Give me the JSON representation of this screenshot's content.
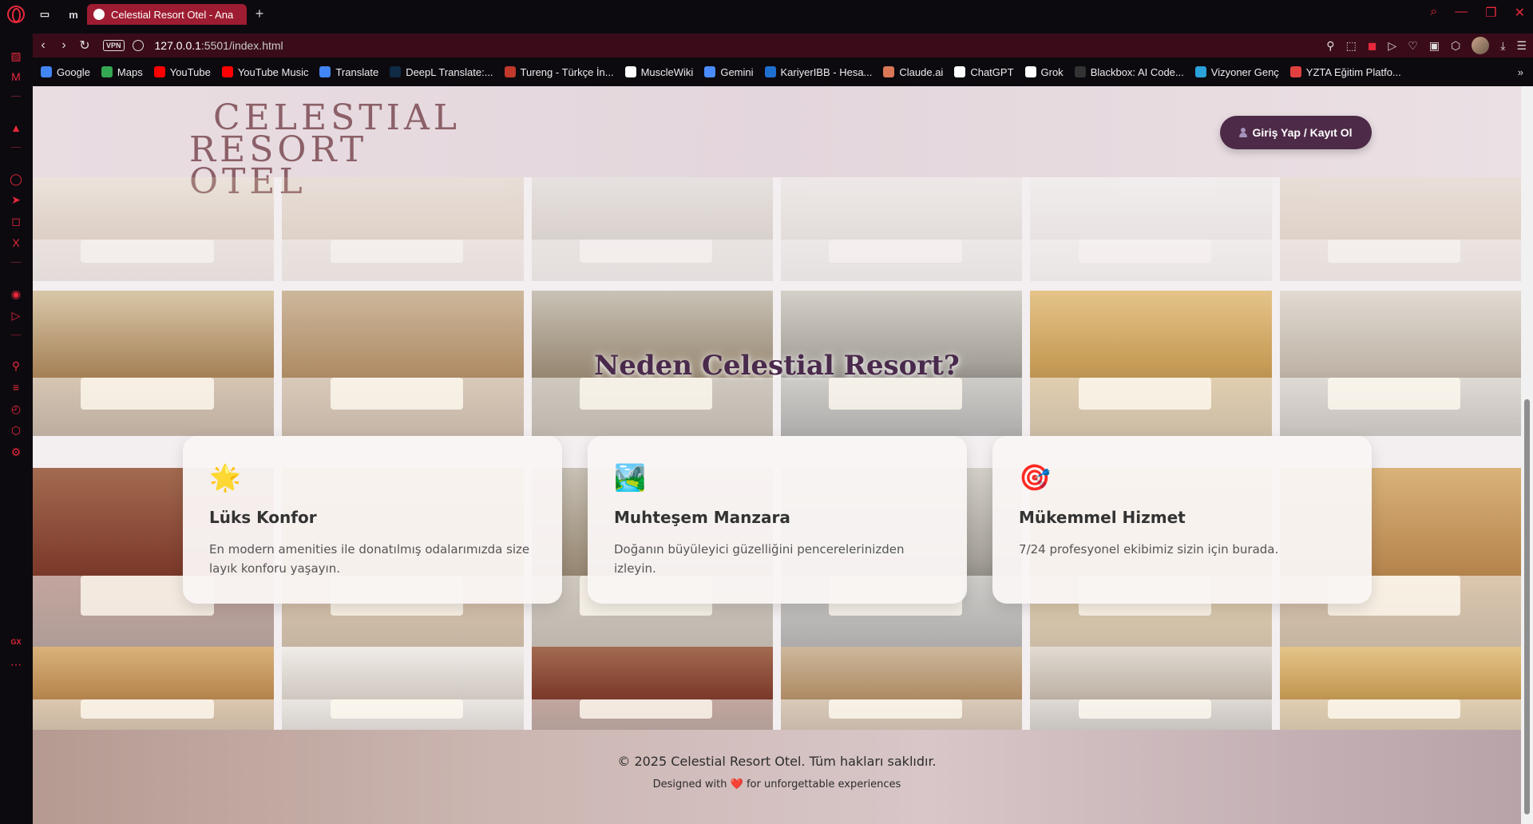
{
  "browser": {
    "tab_title": "Celestial Resort Otel - Ana",
    "new_tab": "+",
    "vpn": "VPN",
    "url_host": "127.0.0.1",
    "url_path": ":5501/index.html",
    "bookmarks": [
      {
        "label": "Google",
        "color": "#4285f4"
      },
      {
        "label": "Maps",
        "color": "#34a853"
      },
      {
        "label": "YouTube",
        "color": "#ff0000"
      },
      {
        "label": "YouTube Music",
        "color": "#ff0000"
      },
      {
        "label": "Translate",
        "color": "#4285f4"
      },
      {
        "label": "DeepL Translate:...",
        "color": "#0f2b46"
      },
      {
        "label": "Tureng - Türkçe İn...",
        "color": "#c0392b"
      },
      {
        "label": "MuscleWiki",
        "color": "#ffffff"
      },
      {
        "label": "Gemini",
        "color": "#4a8cff"
      },
      {
        "label": "KariyerIBB - Hesa...",
        "color": "#1f6fd1"
      },
      {
        "label": "Claude.ai",
        "color": "#d97757"
      },
      {
        "label": "ChatGPT",
        "color": "#ffffff"
      },
      {
        "label": "Grok",
        "color": "#ffffff"
      },
      {
        "label": "Blackbox: AI Code...",
        "color": "#333333"
      },
      {
        "label": "Vizyoner Genç",
        "color": "#2aa1d9"
      },
      {
        "label": "YZTA Eğitim Platfo...",
        "color": "#e04040"
      }
    ]
  },
  "header": {
    "logo_line1": "CELESTIAL",
    "logo_line2": "RESORT OTEL",
    "login_label": "Giriş Yap / Kayıt Ol"
  },
  "section": {
    "title": "Neden Celestial Resort?"
  },
  "features": [
    {
      "icon": "🌟",
      "title": "Lüks Konfor",
      "text": "En modern amenities ile donatılmış odalarımızda size layık konforu yaşayın."
    },
    {
      "icon": "🏞️",
      "title": "Muhteşem Manzara",
      "text": "Doğanın büyüleyici güzelliğini pencerelerinizden izleyin."
    },
    {
      "icon": "🎯",
      "title": "Mükemmel Hizmet",
      "text": "7/24 profesyonel ekibimiz sizin için burada."
    }
  ],
  "footer": {
    "copyright": "© 2025 Celestial Resort Otel. Tüm hakları saklıdır.",
    "designed_prefix": "Designed with",
    "heart": "❤️",
    "designed_suffix": "for unforgettable experiences"
  }
}
